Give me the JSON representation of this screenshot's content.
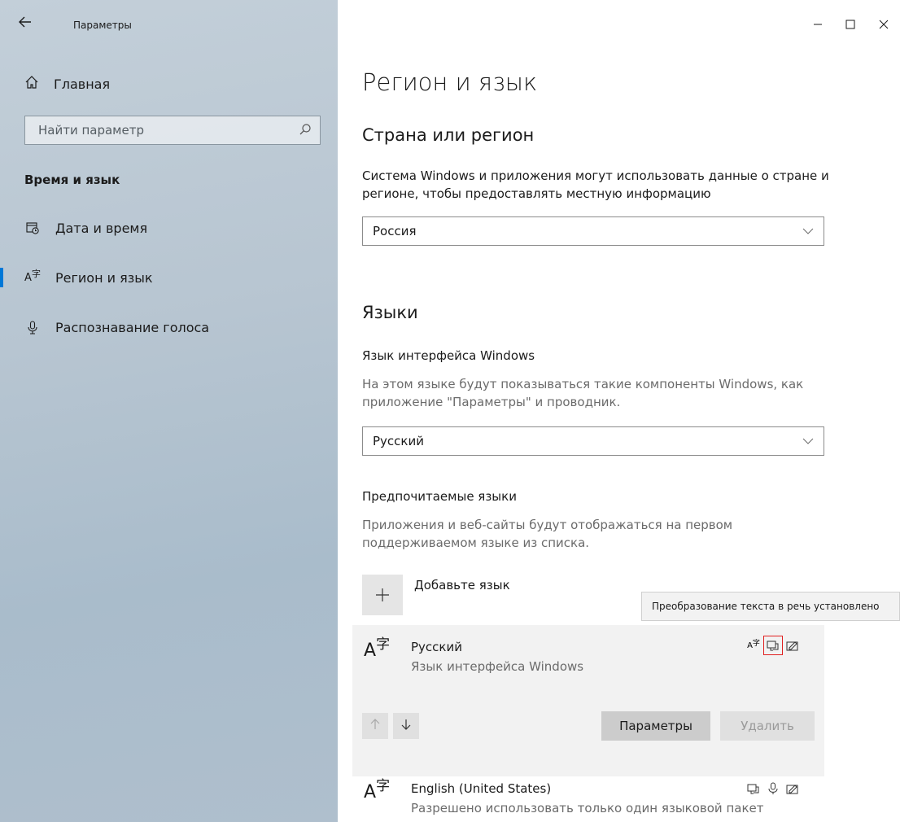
{
  "window": {
    "title": "Параметры",
    "minimize_icon": "minimize-icon",
    "maximize_icon": "maximize-icon",
    "close_icon": "close-icon"
  },
  "sidebar": {
    "home_label": "Главная",
    "search_placeholder": "Найти параметр",
    "section_header": "Время и язык",
    "items": [
      {
        "label": "Дата и время",
        "icon": "calendar-clock-icon"
      },
      {
        "label": "Регион и язык",
        "icon": "language-icon",
        "selected": true
      },
      {
        "label": "Распознавание голоса",
        "icon": "microphone-icon"
      }
    ],
    "accent_color": "#0078d7"
  },
  "main": {
    "title": "Регион и язык",
    "country": {
      "heading": "Страна или регион",
      "description": "Система Windows и приложения могут использовать данные о стране и регионе, чтобы предоставлять местную информацию",
      "selected": "Россия"
    },
    "languages": {
      "heading": "Языки",
      "ui_lang_title": "Язык интерфейса Windows",
      "ui_lang_description": "На этом языке будут показываться такие компоненты Windows, как приложение \"Параметры\" и проводник.",
      "ui_lang_selected": "Русский",
      "preferred_title": "Предпочитаемые языки",
      "preferred_description": "Приложения и веб-сайты будут отображаться на первом поддерживаемом языке из списка.",
      "add_label": "Добавьте язык",
      "tooltip": "Преобразование текста в речь установлено",
      "list": [
        {
          "name": "Русский",
          "sub": "Язык интерфейса Windows"
        },
        {
          "name": "English (United States)",
          "sub": "Разрешено использовать только один языковой пакет"
        }
      ],
      "options_button": "Параметры",
      "remove_button": "Удалить"
    }
  }
}
